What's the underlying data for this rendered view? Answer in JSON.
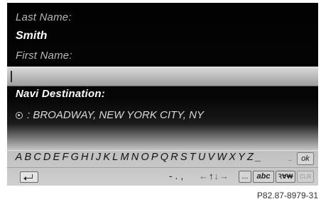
{
  "form": {
    "last_name_label": "Last Name:",
    "last_name_value": "Smith",
    "first_name_label": "First Name:",
    "first_name_value": "",
    "destination_label": "Navi Destination:",
    "destination_value": ": BROADWAY, NEW YORK CITY, NY",
    "destination_icon": "location-pin-icon"
  },
  "keyboard": {
    "letters": [
      "A",
      "B",
      "C",
      "D",
      "E",
      "F",
      "G",
      "H",
      "I",
      "J",
      "K",
      "L",
      "M",
      "N",
      "O",
      "P",
      "Q",
      "R",
      "S",
      "T",
      "U",
      "V",
      "W",
      "X",
      "Y",
      "Z"
    ],
    "underscore_key": "_",
    "ok_label": "ok",
    "dots_label": "..",
    "punctuation": "- . ,",
    "arrows": [
      "←",
      "↑",
      "↓",
      "→"
    ],
    "ellipsis_label": "...",
    "abc_label": "abc",
    "symbols_label": "ꝚⱯ₩",
    "clear_label": "CLR",
    "back_icon": "back-icon"
  },
  "caption": "P82.87-8979-31"
}
